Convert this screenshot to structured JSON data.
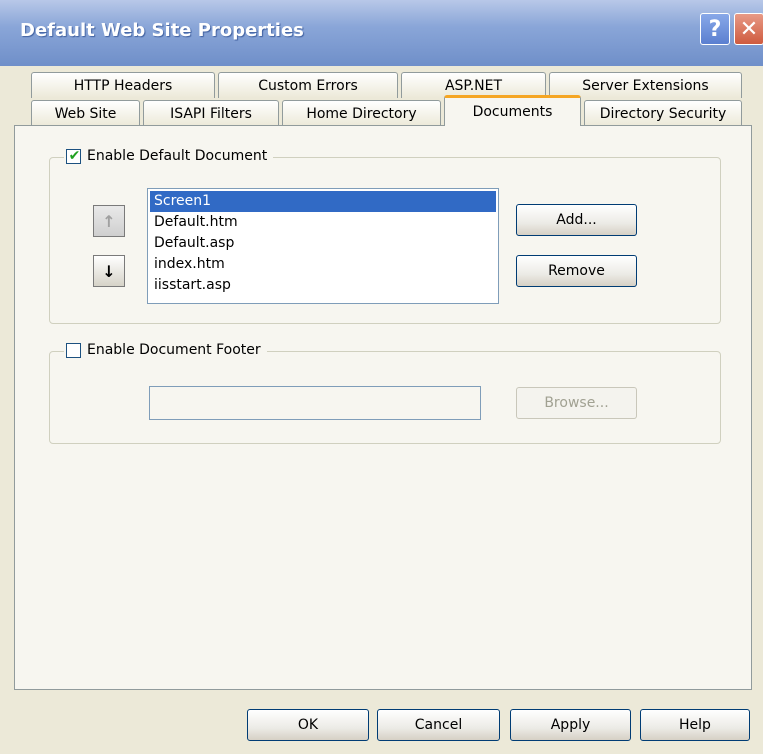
{
  "window": {
    "title": "Default Web Site Properties",
    "help_glyph": "?",
    "close_glyph": "✕"
  },
  "tabs": {
    "row1": [
      "HTTP Headers",
      "Custom Errors",
      "ASP.NET",
      "Server Extensions"
    ],
    "row2": [
      "Web Site",
      "ISAPI Filters",
      "Home Directory",
      "Documents",
      "Directory Security"
    ],
    "active": "Documents"
  },
  "default_doc": {
    "label": "Enable Default Document",
    "checked": true,
    "items": [
      "Screen1",
      "Default.htm",
      "Default.asp",
      "index.htm",
      "iisstart.asp"
    ],
    "selected_index": 0,
    "move_up_glyph": "↑",
    "move_down_glyph": "↓",
    "add_label": "Add...",
    "remove_label": "Remove"
  },
  "footer": {
    "label": "Enable Document Footer",
    "checked": false,
    "path_value": "",
    "browse_label": "Browse..."
  },
  "buttons": {
    "ok": "OK",
    "cancel": "Cancel",
    "apply": "Apply",
    "help": "Help"
  },
  "colors": {
    "title_gradient_start": "#b8c8e8",
    "selection": "#316ac5",
    "active_tab_accent": "#f5a623",
    "dialog_bg": "#ece9d8"
  }
}
